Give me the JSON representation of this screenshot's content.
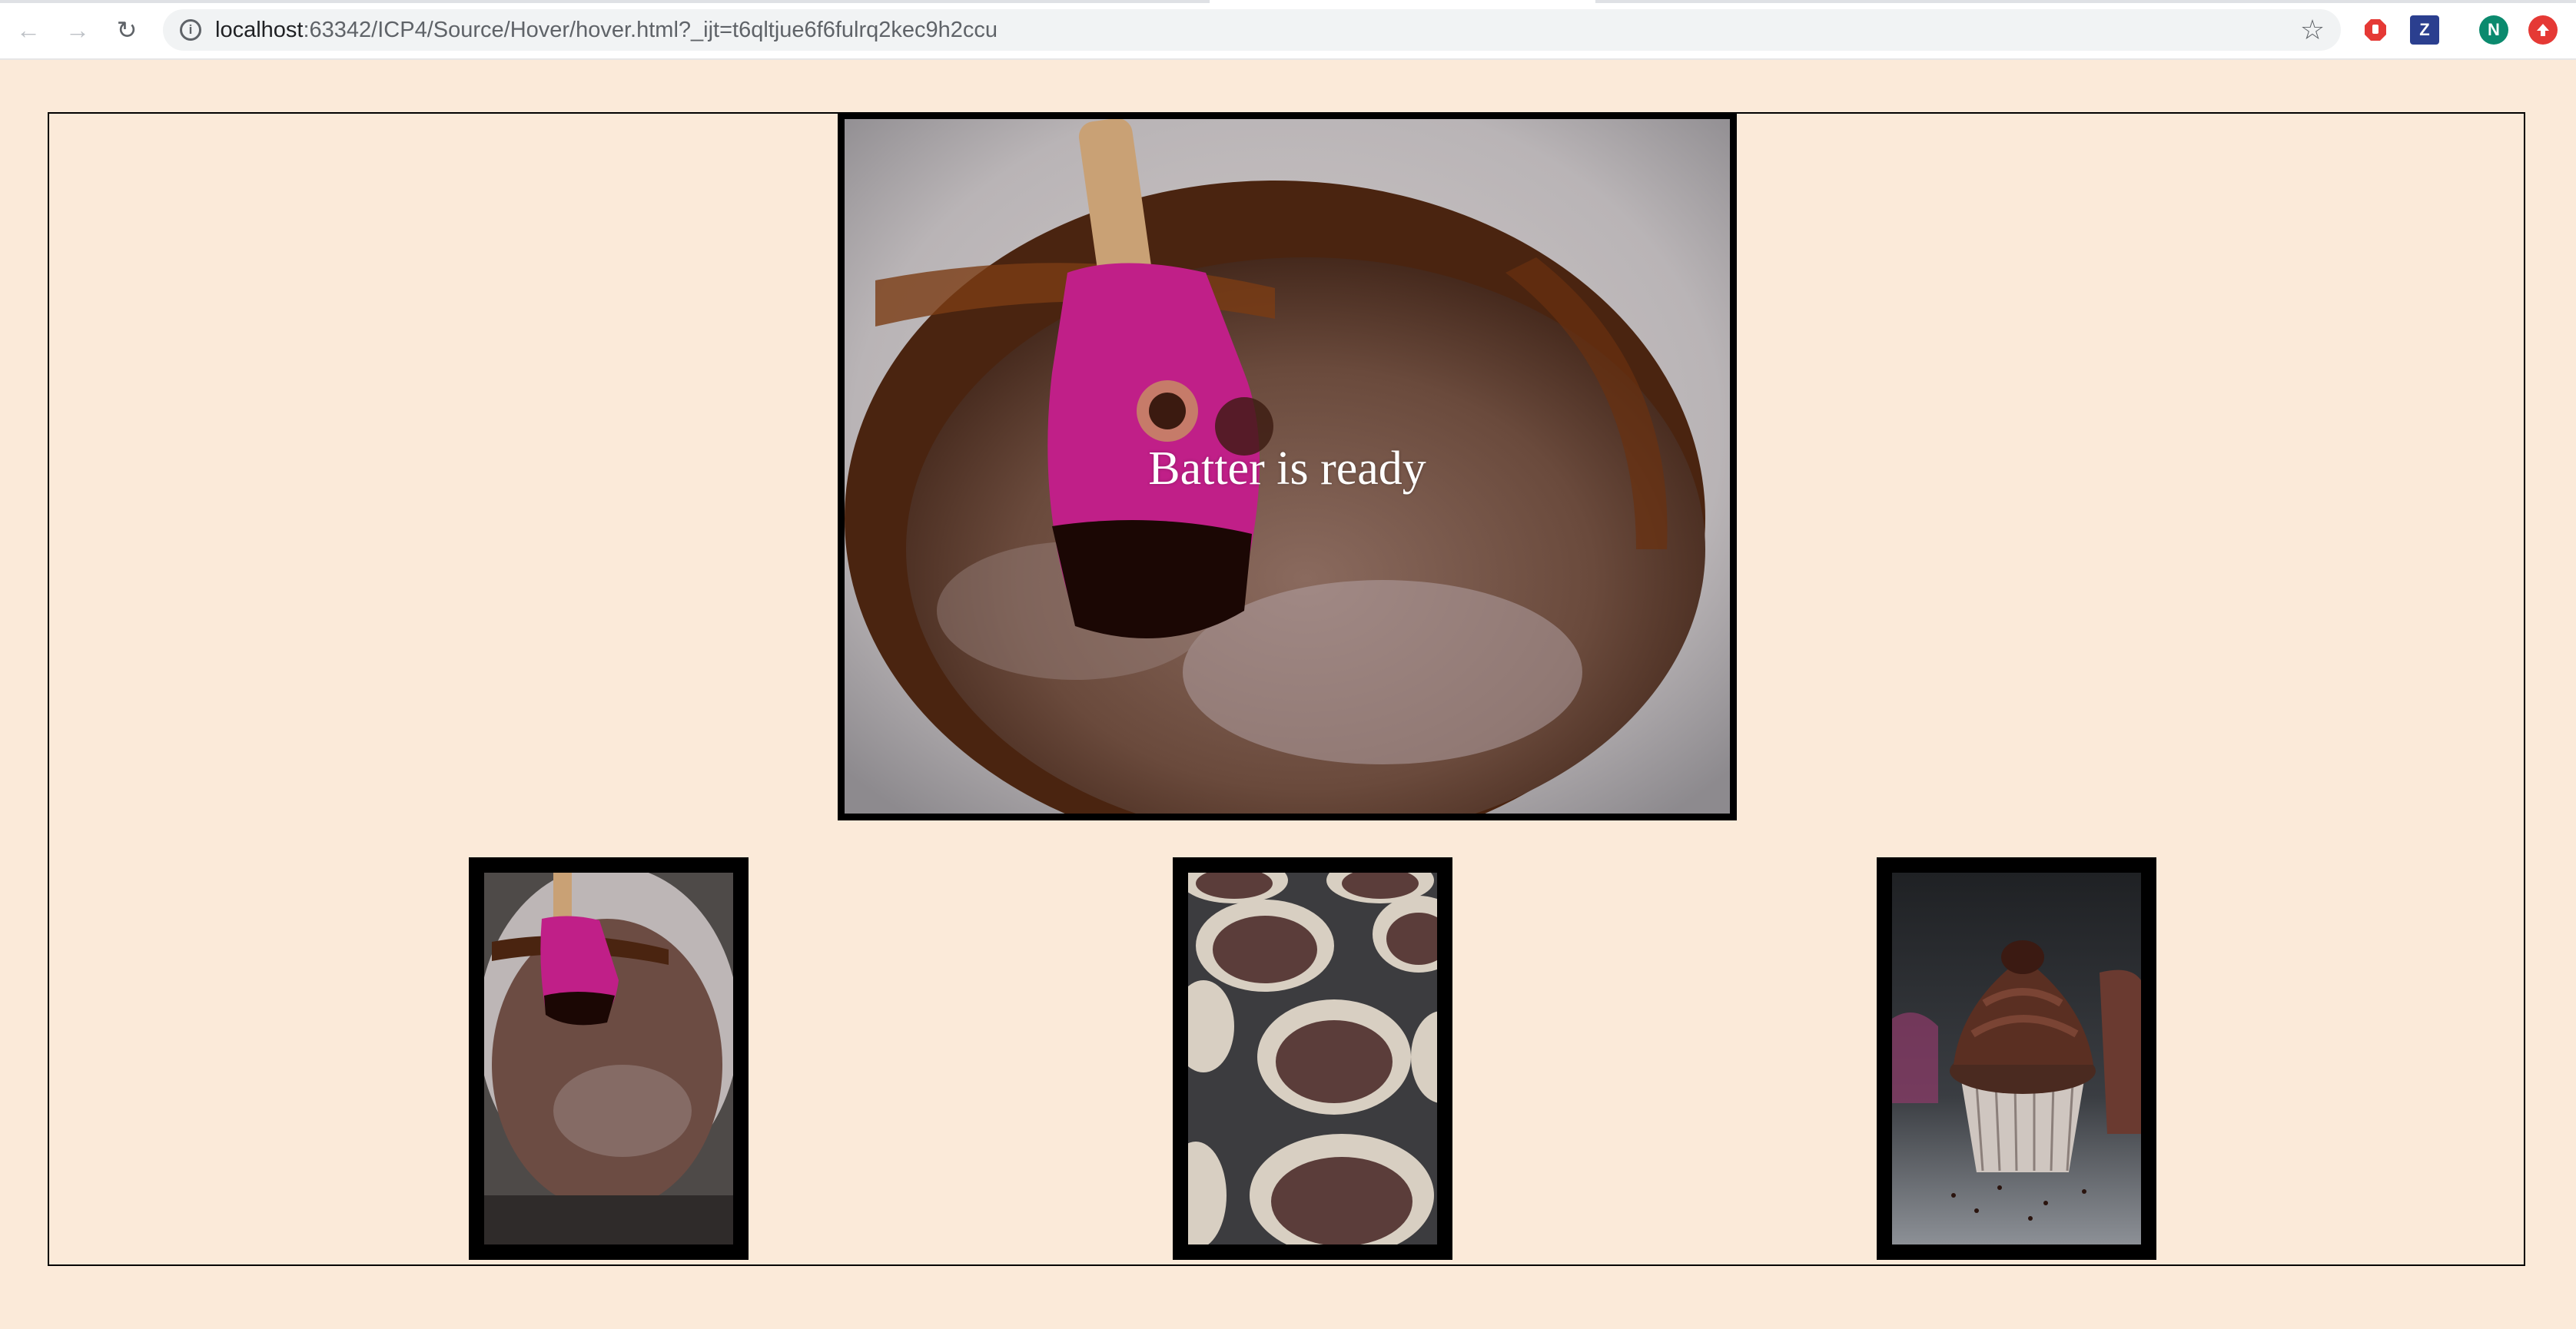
{
  "browser": {
    "url_host": "localhost",
    "url_path": ":63342/ICP4/Source/Hover/hover.html?_ijt=t6qltjue6f6fulrq2kec9h2ccu",
    "extensions": [
      {
        "name": "adblock",
        "color": "#e53935",
        "glyph": ""
      },
      {
        "name": "zotero",
        "color": "#2b3f8f",
        "glyph": "Z"
      },
      {
        "name": "profile",
        "color": "#0b8a6e",
        "glyph": "N"
      },
      {
        "name": "updates",
        "color": "#e53935",
        "glyph": ""
      }
    ]
  },
  "gallery": {
    "hero": {
      "caption": "Batter is ready",
      "image": "chocolate-batter-spatula"
    },
    "thumbnails": [
      {
        "image": "chocolate-batter-spatula"
      },
      {
        "image": "cupcake-tin-filled"
      },
      {
        "image": "frosted-chocolate-cupcake"
      }
    ]
  }
}
